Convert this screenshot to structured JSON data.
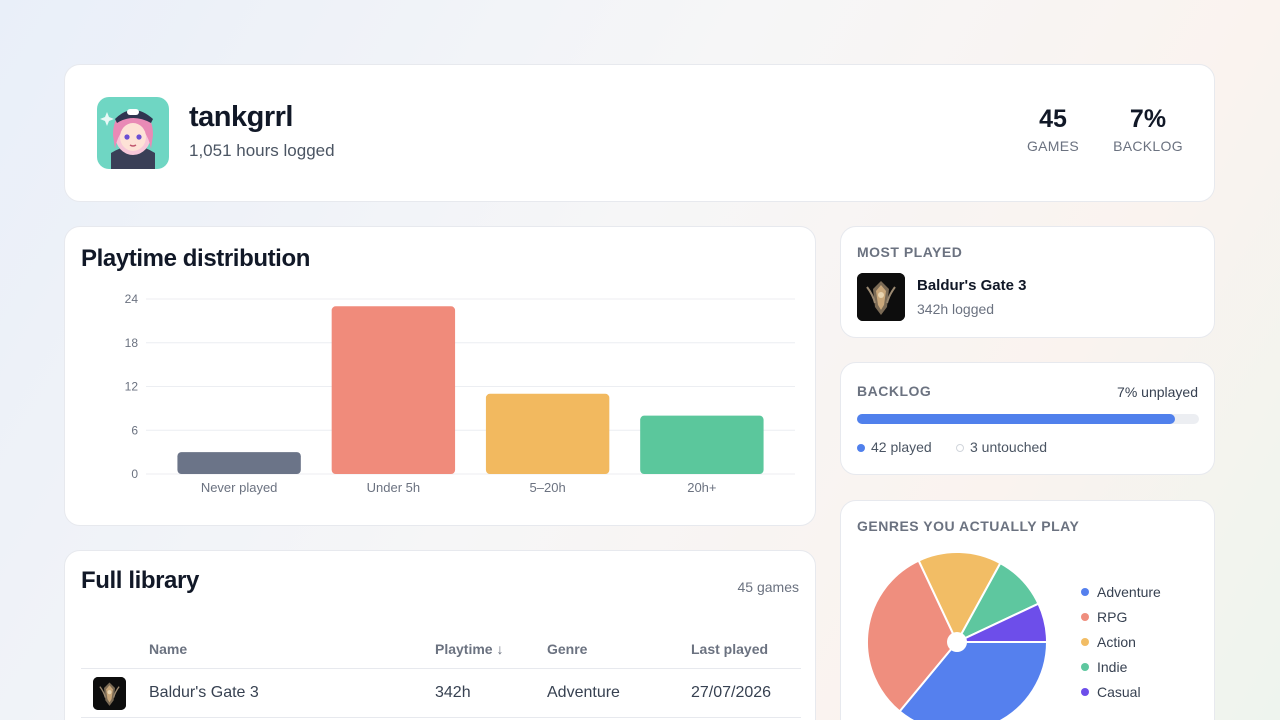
{
  "profile": {
    "username": "tankgrrl",
    "hours_logged": "1,051 hours logged",
    "stats": [
      {
        "value": "45",
        "label": "GAMES"
      },
      {
        "value": "7%",
        "label": "BACKLOG"
      }
    ]
  },
  "playtime": {
    "title": "Playtime distribution"
  },
  "chart_data": {
    "type": "bar",
    "title": "Playtime distribution",
    "categories": [
      "Never played",
      "Under 5h",
      "5–20h",
      "20h+"
    ],
    "values": [
      3,
      23,
      11,
      8
    ],
    "colors": [
      "#6b7488",
      "#f08b7b",
      "#f2b95f",
      "#5bc79c"
    ],
    "yticks": [
      0,
      6,
      12,
      18,
      24
    ],
    "ylim": [
      0,
      24
    ],
    "grid": true
  },
  "library": {
    "title": "Full library",
    "count": "45 games",
    "columns": [
      "Name",
      "Playtime ↓",
      "Genre",
      "Last played"
    ],
    "rows": [
      {
        "name": "Baldur's Gate 3",
        "playtime": "342h",
        "genre": "Adventure",
        "last_played": "27/07/2026"
      }
    ]
  },
  "most_played": {
    "label": "MOST PLAYED",
    "game": "Baldur's Gate 3",
    "hours": "342h logged"
  },
  "backlog": {
    "label": "BACKLOG",
    "unplayed": "7% unplayed",
    "played_fraction": 0.93,
    "played": "42 played",
    "untouched": "3 untouched",
    "played_color": "#5080ec",
    "untouched_color": "#e5e7eb"
  },
  "genres": {
    "label": "GENRES YOU ACTUALLY PLAY",
    "slices": [
      {
        "name": "Adventure",
        "value": 36,
        "color": "#5580ee"
      },
      {
        "name": "RPG",
        "value": 32,
        "color": "#ef8e7e"
      },
      {
        "name": "Action",
        "value": 15,
        "color": "#f2bd65"
      },
      {
        "name": "Indie",
        "value": 10,
        "color": "#5ec79f"
      },
      {
        "name": "Casual",
        "value": 7,
        "color": "#6d4eea"
      }
    ]
  },
  "icons": {
    "avatar": "anime-avatar-icon",
    "game_cover": "baldurs-gate-cover-icon"
  }
}
